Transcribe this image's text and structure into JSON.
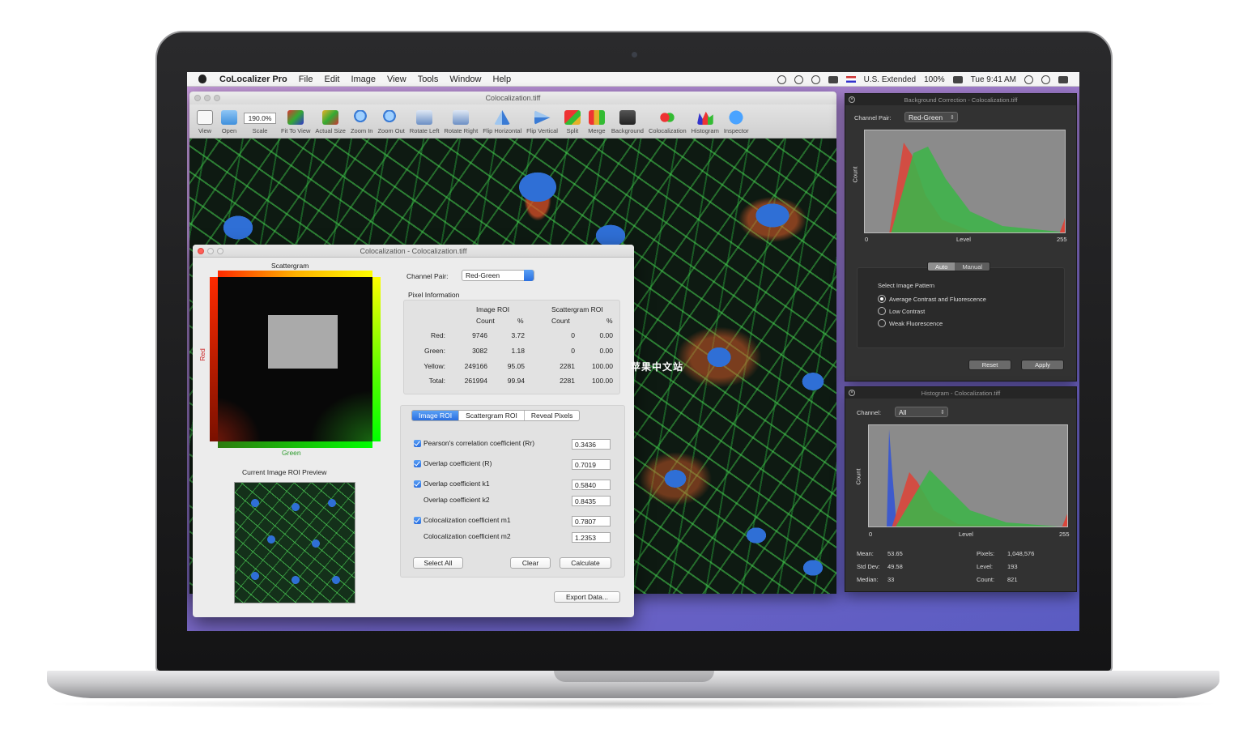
{
  "colors": {
    "accent": "#2a6fe0",
    "red_channel": "#ff2a00",
    "green_channel": "#00ff00",
    "blue_channel": "#2f6fd6"
  },
  "menubar": {
    "app_name": "CoLocalizer Pro",
    "items": [
      "File",
      "Edit",
      "Image",
      "View",
      "Tools",
      "Window",
      "Help"
    ],
    "keyboard": "U.S. Extended",
    "battery": "100%",
    "clock": "Tue 9:41 AM"
  },
  "main_window": {
    "title": "Colocalization.tiff",
    "scale_value": "190.0%",
    "toolbar": [
      "View",
      "Open",
      "Scale",
      "Fit To View",
      "Actual Size",
      "Zoom In",
      "Zoom Out",
      "Rotate Left",
      "Rotate Right",
      "Flip Horizontal",
      "Flip Vertical",
      "Split",
      "Merge",
      "Background",
      "Colocalization",
      "Histogram",
      "Inspector"
    ]
  },
  "coloc": {
    "title": "Colocalization - Colocalization.tiff",
    "scattergram_label": "Scattergram",
    "axis_red": "Red",
    "axis_green": "Green",
    "preview_label": "Current Image ROI Preview",
    "channel_pair_label": "Channel Pair:",
    "channel_pair_value": "Red-Green",
    "pixel_info_label": "Pixel Information",
    "col_image_roi": "Image ROI",
    "col_scatter_roi": "Scattergram ROI",
    "col_count": "Count",
    "col_pct": "%",
    "rows": [
      {
        "name": "Red:",
        "img_count": "9746",
        "img_pct": "3.72",
        "sc_count": "0",
        "sc_pct": "0.00"
      },
      {
        "name": "Green:",
        "img_count": "3082",
        "img_pct": "1.18",
        "sc_count": "0",
        "sc_pct": "0.00"
      },
      {
        "name": "Yellow:",
        "img_count": "249166",
        "img_pct": "95.05",
        "sc_count": "2281",
        "sc_pct": "100.00"
      },
      {
        "name": "Total:",
        "img_count": "261994",
        "img_pct": "99.94",
        "sc_count": "2281",
        "sc_pct": "100.00"
      }
    ],
    "tabs": [
      "Image ROI",
      "Scattergram ROI",
      "Reveal Pixels"
    ],
    "coefficients": [
      {
        "label": "Pearson's correlation coefficient (Rr)",
        "value": "0.3436",
        "checked": true
      },
      {
        "label": "Overlap coefficient (R)",
        "value": "0.7019",
        "checked": true
      },
      {
        "label": "Overlap coefficient k1",
        "value": "0.5840",
        "checked": true
      },
      {
        "label": "Overlap coefficient k2",
        "value": "0.8435",
        "checked": false
      },
      {
        "label": "Colocalization coefficient m1",
        "value": "0.7807",
        "checked": true
      },
      {
        "label": "Colocalization coefficient m2",
        "value": "1.2353",
        "checked": false
      }
    ],
    "btn_select_all": "Select All",
    "btn_clear": "Clear",
    "btn_calculate": "Calculate",
    "btn_export": "Export Data..."
  },
  "bg_panel": {
    "title": "Background Correction - Colocalization.tiff",
    "channel_pair_label": "Channel Pair:",
    "channel_pair_value": "Red-Green",
    "y_label": "Count",
    "x_label": "Level",
    "x_min": "0",
    "x_max": "255",
    "seg": [
      "Auto",
      "Manual"
    ],
    "pattern_label": "Select Image Pattern",
    "options": [
      "Average Contrast and Fluorescence",
      "Low Contrast",
      "Weak Fluorescence"
    ],
    "btn_reset": "Reset",
    "btn_apply": "Apply"
  },
  "hist_panel": {
    "title": "Histogram - Colocalization.tiff",
    "channel_label": "Channel:",
    "channel_value": "All",
    "y_label": "Count",
    "x_label": "Level",
    "x_min": "0",
    "x_max": "255",
    "stats": [
      {
        "label": "Mean:",
        "value": "53.65"
      },
      {
        "label": "Std Dev:",
        "value": "49.58"
      },
      {
        "label": "Median:",
        "value": "33"
      },
      {
        "label": "Pixels:",
        "value": "1,048,576"
      },
      {
        "label": "Level:",
        "value": "193"
      },
      {
        "label": "Count:",
        "value": "821"
      }
    ]
  },
  "watermark": "苹果中文站"
}
